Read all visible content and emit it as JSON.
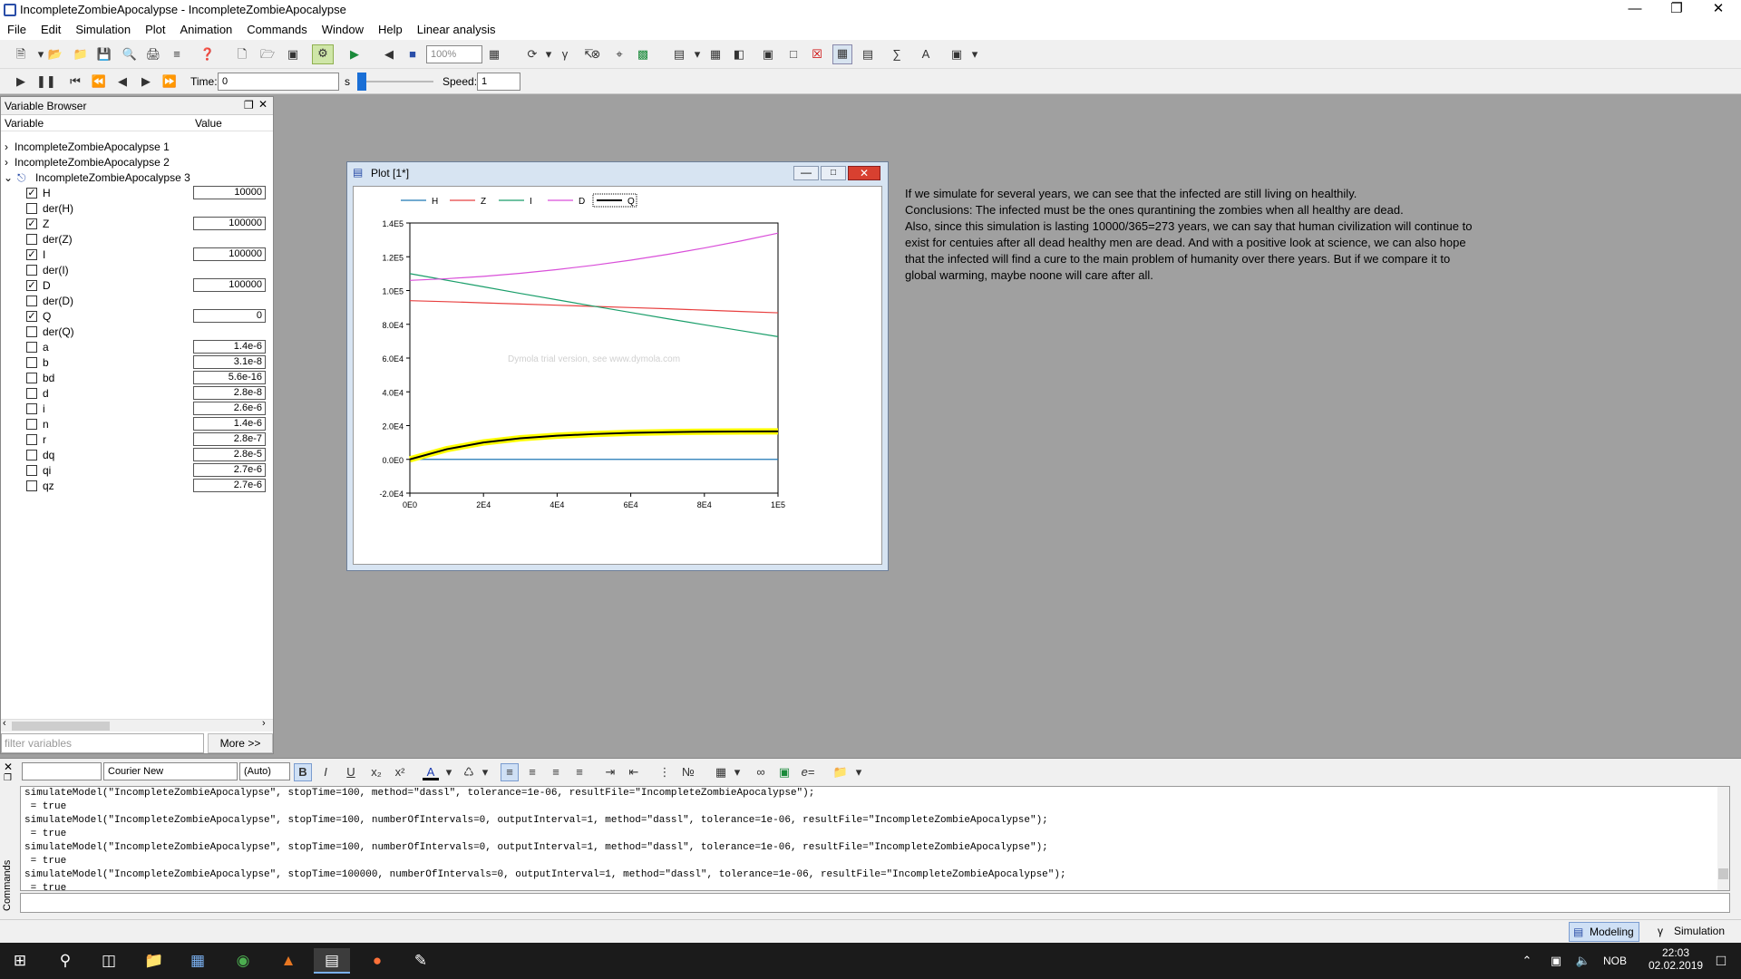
{
  "window": {
    "title": "IncompleteZombieApocalypse - IncompleteZombieApocalypse"
  },
  "menu": [
    "File",
    "Edit",
    "Simulation",
    "Plot",
    "Animation",
    "Commands",
    "Window",
    "Help",
    "Linear analysis"
  ],
  "toolbar": {
    "zoom": "100%"
  },
  "animation_bar": {
    "time_label": "Time:",
    "time_value": "0",
    "time_unit": "s",
    "speed_label": "Speed:",
    "speed_value": "1"
  },
  "variable_browser": {
    "title": "Variable Browser",
    "col_variable": "Variable",
    "col_value": "Value",
    "results": [
      "IncompleteZombieApocalypse 1",
      "IncompleteZombieApocalypse 2",
      "IncompleteZombieApocalypse 3"
    ],
    "rows": [
      {
        "name": "H",
        "checked": true,
        "value": "10000"
      },
      {
        "name": "der(H)",
        "checked": false,
        "value": ""
      },
      {
        "name": "Z",
        "checked": true,
        "value": "100000"
      },
      {
        "name": "der(Z)",
        "checked": false,
        "value": ""
      },
      {
        "name": "I",
        "checked": true,
        "value": "100000"
      },
      {
        "name": "der(I)",
        "checked": false,
        "value": ""
      },
      {
        "name": "D",
        "checked": true,
        "value": "100000"
      },
      {
        "name": "der(D)",
        "checked": false,
        "value": ""
      },
      {
        "name": "Q",
        "checked": true,
        "value": "0"
      },
      {
        "name": "der(Q)",
        "checked": false,
        "value": ""
      },
      {
        "name": "a",
        "checked": false,
        "value": "1.4e-6"
      },
      {
        "name": "b",
        "checked": false,
        "value": "3.1e-8"
      },
      {
        "name": "bd",
        "checked": false,
        "value": "5.6e-16"
      },
      {
        "name": "d",
        "checked": false,
        "value": "2.8e-8"
      },
      {
        "name": "i",
        "checked": false,
        "value": "2.6e-6"
      },
      {
        "name": "n",
        "checked": false,
        "value": "1.4e-6"
      },
      {
        "name": "r",
        "checked": false,
        "value": "2.8e-7"
      },
      {
        "name": "dq",
        "checked": false,
        "value": "2.8e-5"
      },
      {
        "name": "qi",
        "checked": false,
        "value": "2.7e-6"
      },
      {
        "name": "qz",
        "checked": false,
        "value": "2.7e-6"
      }
    ],
    "filter_placeholder": "filter variables",
    "more_button": "More >>"
  },
  "plot_window": {
    "title": "Plot [1*]",
    "watermark": "Dymola trial version, see www.dymola.com"
  },
  "chart_data": {
    "type": "line",
    "x": [
      0,
      10000,
      20000,
      30000,
      40000,
      50000,
      60000,
      70000,
      80000,
      90000,
      100000
    ],
    "xticks": [
      "0E0",
      "2E4",
      "4E4",
      "6E4",
      "8E4",
      "1E5"
    ],
    "yticks": [
      "1.4E5",
      "1.2E5",
      "1.0E5",
      "8.0E4",
      "6.0E4",
      "4.0E4",
      "2.0E4",
      "0.0E0",
      "-2.0E4"
    ],
    "xlim": [
      0,
      100000
    ],
    "ylim": [
      -20000,
      140000
    ],
    "grid": false,
    "legend_position": "top",
    "series": [
      {
        "name": "H",
        "color": "#1f77b4",
        "values": [
          0,
          0,
          0,
          0,
          0,
          0,
          0,
          0,
          0,
          0,
          0
        ]
      },
      {
        "name": "Z",
        "color": "#e84040",
        "values": [
          94000,
          93400,
          92700,
          92000,
          91300,
          90600,
          89900,
          89200,
          88400,
          87600,
          86800
        ]
      },
      {
        "name": "I",
        "color": "#1a9e6a",
        "values": [
          110000,
          106100,
          102200,
          98300,
          94500,
          90700,
          87000,
          83300,
          79700,
          76200,
          72700
        ]
      },
      {
        "name": "D",
        "color": "#d94fd9",
        "values": [
          106000,
          107000,
          108400,
          110200,
          112400,
          115000,
          118000,
          121400,
          125200,
          129400,
          134000
        ]
      },
      {
        "name": "Q",
        "color": "#000000",
        "values": [
          0,
          6000,
          10000,
          12500,
          14000,
          15000,
          15700,
          16100,
          16400,
          16500,
          16600
        ]
      }
    ]
  },
  "notes": [
    "If we simulate for several years, we can see that the infected are still living on healthily.",
    "Conclusions: The infected must be the ones qurantining the zombies when all healthy are dead.",
    "Also, since this simulation is lasting 10000/365=273 years, we can say that human civilization will continue to",
    "exist for centuies after all dead healthy men are dead. And with a positive look at science, we can also hope",
    "that the infected will find a cure to the main problem of humanity over there years. But if we compare it to",
    "global warming, maybe noone will care after all."
  ],
  "commands": {
    "panel_label": "Commands",
    "font_family_value": "Courier New",
    "font_size_value": "(Auto)",
    "log": [
      "simulateModel(\"IncompleteZombieApocalypse\", stopTime=100, method=\"dassl\", tolerance=1e-06, resultFile=\"IncompleteZombieApocalypse\");",
      " = true",
      "simulateModel(\"IncompleteZombieApocalypse\", stopTime=100, numberOfIntervals=0, outputInterval=1, method=\"dassl\", tolerance=1e-06, resultFile=\"IncompleteZombieApocalypse\");",
      " = true",
      "simulateModel(\"IncompleteZombieApocalypse\", stopTime=100, numberOfIntervals=0, outputInterval=1, method=\"dassl\", tolerance=1e-06, resultFile=\"IncompleteZombieApocalypse\");",
      " = true",
      "simulateModel(\"IncompleteZombieApocalypse\", stopTime=100000, numberOfIntervals=0, outputInterval=1, method=\"dassl\", tolerance=1e-06, resultFile=\"IncompleteZombieApocalypse\");",
      " = true"
    ]
  },
  "status": {
    "modeling": "Modeling",
    "simulation": "Simulation"
  },
  "taskbar": {
    "lang": "NOB",
    "time": "22:03",
    "date": "02.02.2019"
  }
}
